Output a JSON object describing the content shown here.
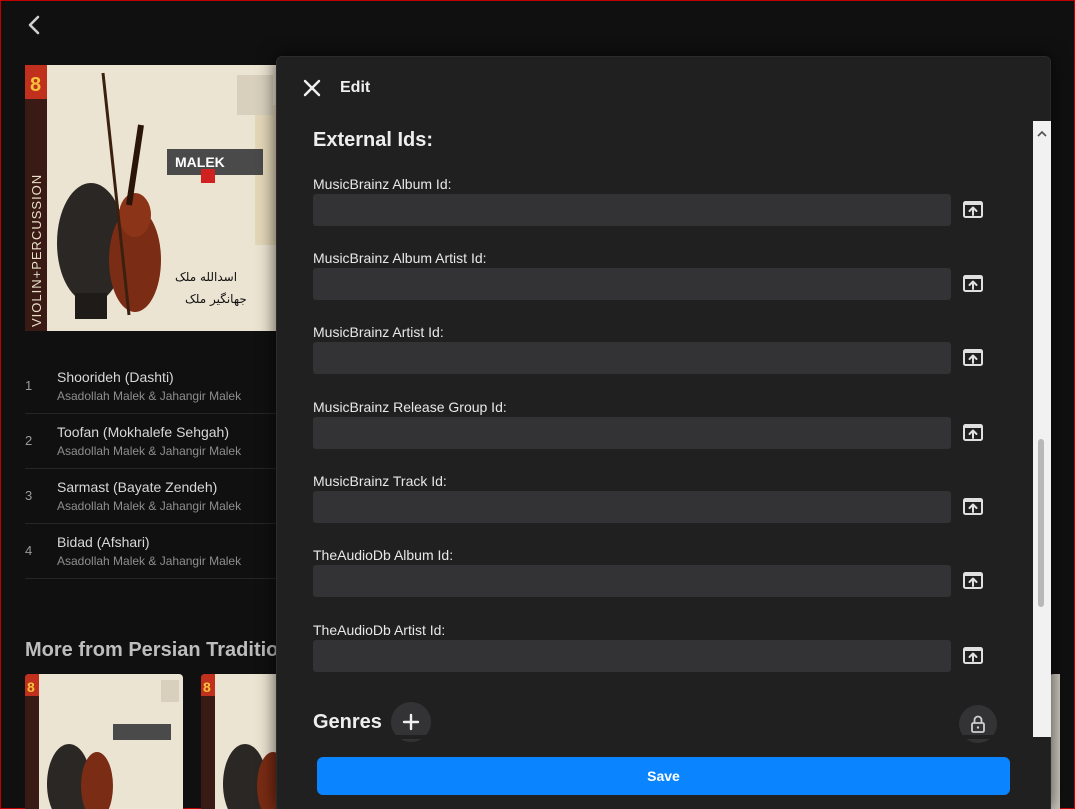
{
  "album": {
    "tracks": [
      {
        "number": "1",
        "title": "Shoorideh (Dashti)",
        "artist": "Asadollah Malek & Jahangir Malek"
      },
      {
        "number": "2",
        "title": "Toofan (Mokhalefe Sehgah)",
        "artist": "Asadollah Malek & Jahangir Malek"
      },
      {
        "number": "3",
        "title": "Sarmast (Bayate Zendeh)",
        "artist": "Asadollah Malek & Jahangir Malek"
      },
      {
        "number": "4",
        "title": "Bidad (Afshari)",
        "artist": "Asadollah Malek & Jahangir Malek"
      }
    ],
    "more_from_title": "More from Persian Tradition"
  },
  "dialog": {
    "title": "Edit",
    "section_title": "External Ids:",
    "fields": [
      {
        "label": "MusicBrainz Album Id:",
        "value": ""
      },
      {
        "label": "MusicBrainz Album Artist Id:",
        "value": ""
      },
      {
        "label": "MusicBrainz Artist Id:",
        "value": ""
      },
      {
        "label": "MusicBrainz Release Group Id:",
        "value": ""
      },
      {
        "label": "MusicBrainz Track Id:",
        "value": ""
      },
      {
        "label": "TheAudioDb Album Id:",
        "value": ""
      },
      {
        "label": "TheAudioDb Artist Id:",
        "value": ""
      }
    ],
    "genres_title": "Genres",
    "save_label": "Save"
  },
  "colors": {
    "accent": "#0a84ff",
    "dialog_bg": "#202020",
    "input_bg": "#333336",
    "page_bg": "#101010"
  }
}
